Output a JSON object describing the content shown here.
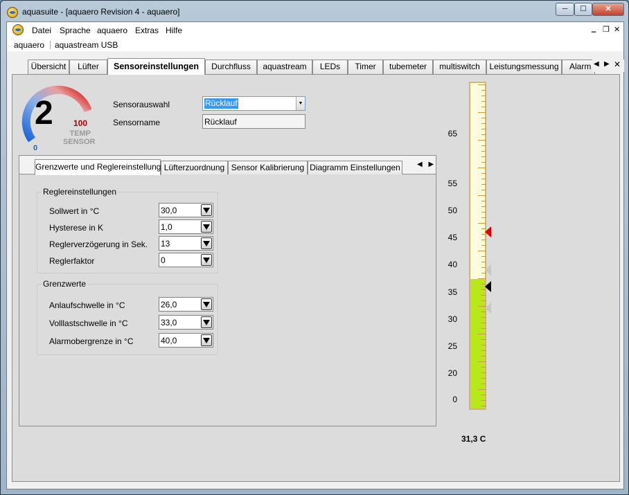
{
  "window": {
    "title": "aquasuite - [aquaero Revision 4 -  aquaero]",
    "min": "─",
    "max": "☐",
    "close": "✕"
  },
  "menu": [
    "Datei",
    "Sprache",
    "aquaero",
    "Extras",
    "Hilfe"
  ],
  "menu_controls": [
    "‗",
    "❐",
    "✕"
  ],
  "devices": [
    "aquaero",
    "aquastream USB"
  ],
  "tabs": [
    "Übersicht",
    "Lüfter",
    "Sensoreinstellungen",
    "Durchfluss",
    "aquastream",
    "LEDs",
    "Timer",
    "tubemeter",
    "multiswitch",
    "Leistungsmessung",
    "Alarm &"
  ],
  "active_tab_index": 2,
  "tab_nav": {
    "left": "◀",
    "right": "▶",
    "close": "✕"
  },
  "gauge": {
    "number": "2",
    "max": "100",
    "min": "0",
    "line1": "TEMP",
    "line2": "SENSOR"
  },
  "sensor": {
    "select_label": "Sensorauswahl",
    "select_value": "Rücklauf",
    "name_label": "Sensorname",
    "name_value": "Rücklauf"
  },
  "subtabs": [
    "Grenzwerte und Reglereinstellung",
    "Lüfterzuordnung",
    "Sensor Kalibrierung",
    "Diagramm Einstellungen"
  ],
  "subtab_nav": {
    "left": "◀",
    "right": "▶"
  },
  "regler": {
    "title": "Reglereinstellungen",
    "rows": [
      {
        "label": "Sollwert in °C",
        "value": "30,0"
      },
      {
        "label": "Hysterese in K",
        "value": "1,0"
      },
      {
        "label": "Reglerverzögerung in Sek.",
        "value": "13"
      },
      {
        "label": "Reglerfaktor",
        "value": "0"
      }
    ]
  },
  "grenz": {
    "title": "Grenzwerte",
    "rows": [
      {
        "label": "Anlaufschwelle in °C",
        "value": "26,0"
      },
      {
        "label": "Volllastschwelle in °C",
        "value": "33,0"
      },
      {
        "label": "Alarmobergrenze in °C",
        "value": "40,0"
      }
    ]
  },
  "thermometer": {
    "scale_labels": [
      "65",
      "55",
      "50",
      "45",
      "40",
      "35",
      "30",
      "25",
      "20",
      "0"
    ],
    "current_value": 31.3,
    "readout": "31,3 C",
    "markers": [
      {
        "value": 40.0,
        "color": "#e00000"
      },
      {
        "value": 33.0,
        "color": "#c8c8c8"
      },
      {
        "value": 30.0,
        "color": "#000000"
      },
      {
        "value": 26.0,
        "color": "#c8c8c8"
      }
    ],
    "fill_color": "#b9e81a"
  }
}
